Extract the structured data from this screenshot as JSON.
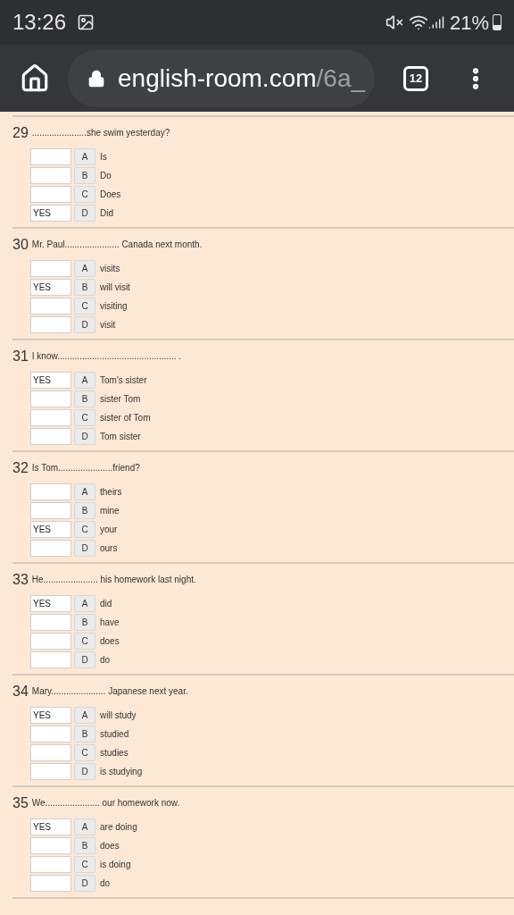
{
  "status_bar": {
    "time": "13:26",
    "battery": "21%"
  },
  "browser": {
    "url_host": "english-room.com",
    "url_path": "/6a_",
    "tab_count": "12"
  },
  "questions": [
    {
      "number": "29",
      "text": "......................she swim yesterday?",
      "options": [
        {
          "letter": "A",
          "label": "Is"
        },
        {
          "letter": "B",
          "label": "Do"
        },
        {
          "letter": "C",
          "label": "Does"
        },
        {
          "letter": "D",
          "label": "Did",
          "value": "YES"
        }
      ]
    },
    {
      "number": "30",
      "text": "Mr. Paul...................... Canada next month.",
      "options": [
        {
          "letter": "A",
          "label": "visits"
        },
        {
          "letter": "B",
          "label": "will visit",
          "value": "YES"
        },
        {
          "letter": "C",
          "label": "visiting"
        },
        {
          "letter": "D",
          "label": "visit"
        }
      ]
    },
    {
      "number": "31",
      "text": "I know................................................ .",
      "options": [
        {
          "letter": "A",
          "label": "Tom's sister",
          "value": "YES"
        },
        {
          "letter": "B",
          "label": "sister Tom"
        },
        {
          "letter": "C",
          "label": "sister of Tom"
        },
        {
          "letter": "D",
          "label": "Tom sister"
        }
      ]
    },
    {
      "number": "32",
      "text": "Is Tom......................friend?",
      "options": [
        {
          "letter": "A",
          "label": "theirs"
        },
        {
          "letter": "B",
          "label": "mine"
        },
        {
          "letter": "C",
          "label": "your",
          "value": "YES"
        },
        {
          "letter": "D",
          "label": "ours"
        }
      ]
    },
    {
      "number": "33",
      "text": "He...................... his homework last night.",
      "options": [
        {
          "letter": "A",
          "label": "did",
          "value": "YES"
        },
        {
          "letter": "B",
          "label": "have"
        },
        {
          "letter": "C",
          "label": "does"
        },
        {
          "letter": "D",
          "label": "do"
        }
      ]
    },
    {
      "number": "34",
      "text": "Mary...................... Japanese next year.",
      "options": [
        {
          "letter": "A",
          "label": "will study",
          "value": "YES"
        },
        {
          "letter": "B",
          "label": "studied"
        },
        {
          "letter": "C",
          "label": "studies"
        },
        {
          "letter": "D",
          "label": "is studying"
        }
      ]
    },
    {
      "number": "35",
      "text": "We...................... our homework now.",
      "options": [
        {
          "letter": "A",
          "label": "are doing",
          "value": "YES"
        },
        {
          "letter": "B",
          "label": "does"
        },
        {
          "letter": "C",
          "label": "is doing"
        },
        {
          "letter": "D",
          "label": "do"
        }
      ]
    }
  ]
}
